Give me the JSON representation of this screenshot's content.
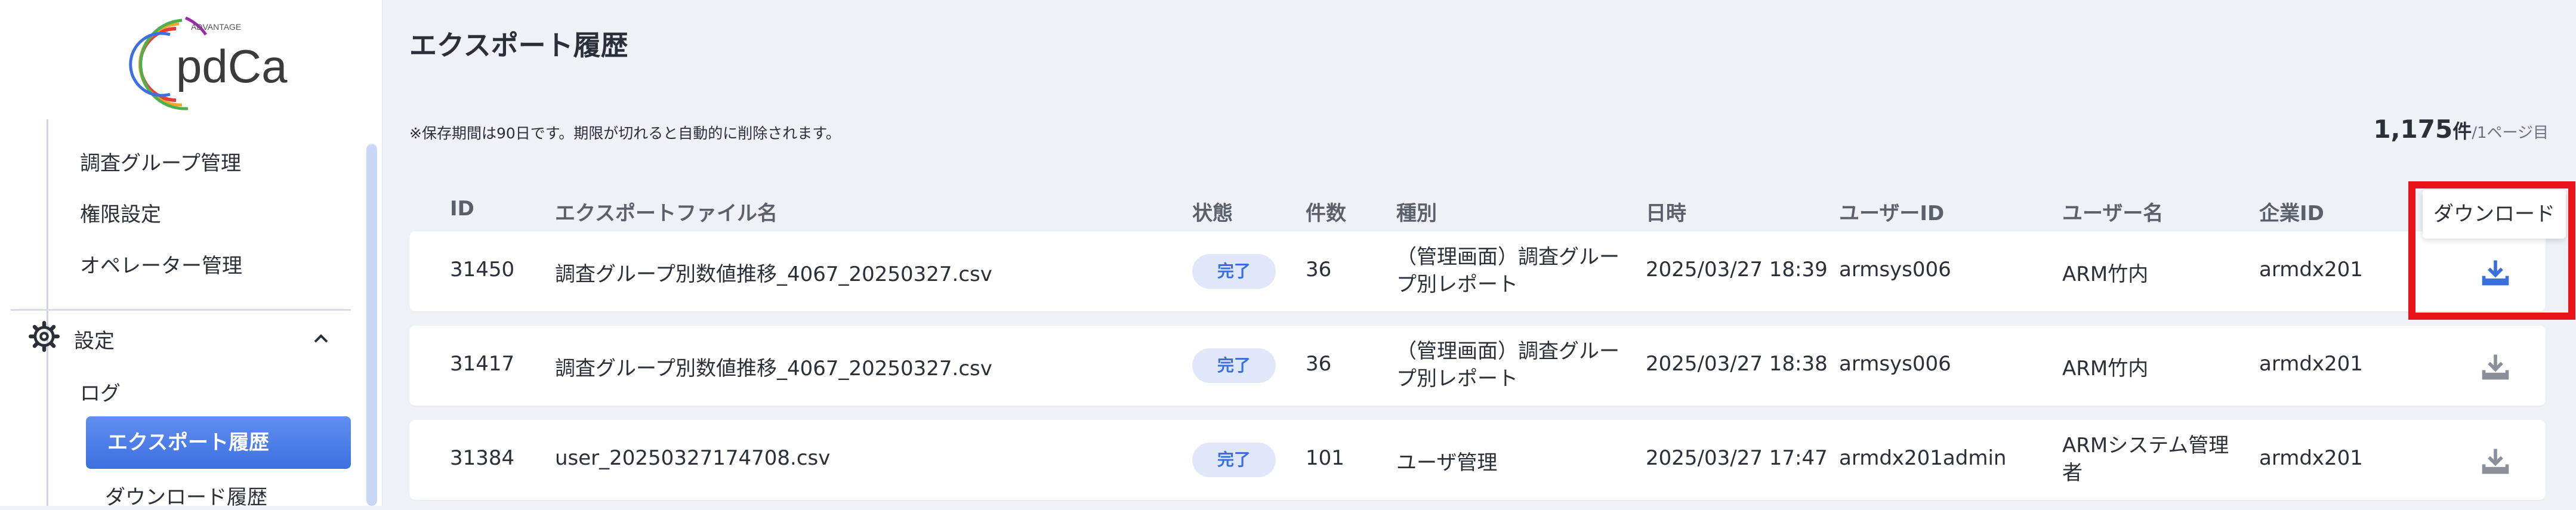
{
  "sidebar": {
    "logo_small": "ADVANTAGE",
    "logo_text": "pdCa",
    "items": [
      {
        "label": "調査グループ管理"
      },
      {
        "label": "権限設定"
      },
      {
        "label": "オペレーター管理"
      }
    ],
    "settings_label": "設定",
    "log_label": "ログ",
    "active_item": "エクスポート履歴",
    "download_history": "ダウンロード履歴"
  },
  "main": {
    "title": "エクスポート履歴",
    "notice": "※保存期間は90日です。期限が切れると自動的に削除されます。",
    "count_num": "1,175",
    "count_unit": "件",
    "count_page": "/1ページ目",
    "tooltip": "ダウンロード"
  },
  "table": {
    "headers": [
      "ID",
      "エクスポートファイル名",
      "状態",
      "件数",
      "種別",
      "日時",
      "ユーザーID",
      "ユーザー名",
      "企業ID"
    ],
    "rows": [
      {
        "id": "31450",
        "file": "調査グループ別数値推移_4067_20250327.csv",
        "status": "完了",
        "count": "36",
        "type": "（管理画面）調査グループ別レポート",
        "datetime": "2025/03/27 18:39",
        "user_id": "armsys006",
        "user_name": "ARM竹内",
        "company": "armdx201"
      },
      {
        "id": "31417",
        "file": "調査グループ別数値推移_4067_20250327.csv",
        "status": "完了",
        "count": "36",
        "type": "（管理画面）調査グループ別レポート",
        "datetime": "2025/03/27 18:38",
        "user_id": "armsys006",
        "user_name": "ARM竹内",
        "company": "armdx201"
      },
      {
        "id": "31384",
        "file": "user_20250327174708.csv",
        "status": "完了",
        "count": "101",
        "type": "ユーザ管理",
        "datetime": "2025/03/27 17:47",
        "user_id": "armdx201admin",
        "user_name": "ARMシステム管理者",
        "company": "armdx201"
      }
    ]
  },
  "colors": {
    "accent": "#3e6fe0",
    "highlight": "#e81419",
    "badge_bg": "#dfe7f8",
    "download_active": "#3a6fe0",
    "download_idle": "#8a8f99"
  }
}
